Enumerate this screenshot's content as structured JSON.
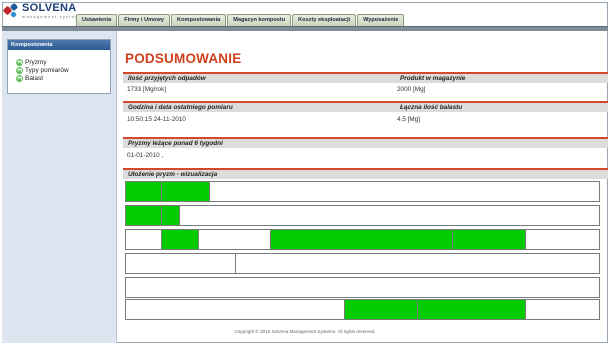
{
  "app": {
    "logo_name": "SOLVENA",
    "logo_sub": "management systems"
  },
  "tabs": [
    {
      "label": "Ustawienia"
    },
    {
      "label": "Firmy i Umowy"
    },
    {
      "label": "Kompostowania"
    },
    {
      "label": "Magazyn kompostu"
    },
    {
      "label": "Koszty eksploatacji"
    },
    {
      "label": "Wyposażenie"
    }
  ],
  "sidebar": {
    "panel_title": "Kompostownia",
    "items": [
      {
        "label": "Pryzmy",
        "icon": "leaf-icon"
      },
      {
        "label": "Typy pomiarów",
        "icon": "leaf-icon"
      },
      {
        "label": "Balast",
        "icon": "leaf-icon"
      }
    ]
  },
  "summary": {
    "title": "PODSUMOWANIE",
    "s1": {
      "h1": "Ilość przyjętych odpadów",
      "h2": "Produkt w magazynie",
      "v1": "1733 [Mg/rok]",
      "v2": "2000 [Mg]"
    },
    "s2": {
      "h1": "Godzina i data ostatniego pomiaru",
      "h2": "Łączna ilość balastu",
      "v1": "10:50:15 24-11-2010",
      "v2": "4.5 [Mg]"
    },
    "s3": {
      "h1": "Pryzmy leżące ponad 6 tygodni",
      "v1": "01-01-2010 ,"
    },
    "s4": {
      "h1": "Ułożenie pryzm - wizualizacja"
    }
  },
  "visualization": {
    "fill_color": "#00cc00",
    "rows": [
      [
        {
          "filled": true
        },
        {
          "filled": true
        },
        {
          "filled": false
        }
      ],
      [
        {
          "filled": true
        },
        {
          "filled": true
        },
        {
          "filled": false
        }
      ],
      [
        {
          "filled": false
        },
        {
          "filled": true
        },
        {
          "filled": false
        },
        {
          "filled": true
        },
        {
          "filled": true
        },
        {
          "filled": false
        }
      ],
      [
        {
          "filled": false
        },
        {
          "filled": false
        }
      ],
      [
        {
          "filled": false
        }
      ],
      [
        {
          "filled": false
        },
        {
          "filled": true
        },
        {
          "filled": true
        },
        {
          "filled": false
        }
      ]
    ]
  },
  "footer": {
    "text": "Copyright © 2010 Solvena Management Systems. All rights reserved."
  }
}
